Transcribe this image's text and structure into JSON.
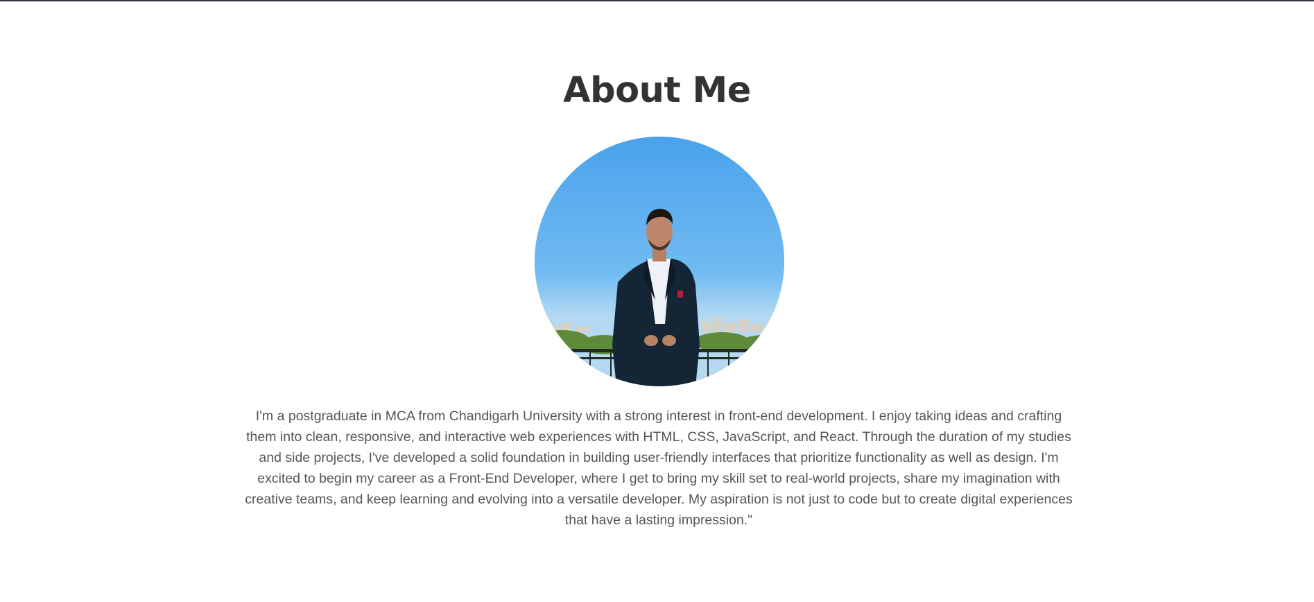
{
  "about": {
    "title": "About Me",
    "photo_alt": "Profile photo",
    "description": "I'm a postgraduate in MCA from Chandigarh University with a strong interest in front-end development. I enjoy taking ideas and crafting them into clean, responsive, and interactive web experiences with HTML, CSS, JavaScript, and React. Through the duration of my studies and side projects, I've developed a solid foundation in building user-friendly interfaces that prioritize functionality as well as design. I'm excited to begin my career as a Front-End Developer, where I get to bring my skill set to real-world projects, share my imagination with creative teams, and keep learning and evolving into a versatile developer. My aspiration is not just to code but to create digital experiences that have a lasting impression.\""
  },
  "colors": {
    "title": "#333333",
    "body_text": "#555555",
    "top_rule": "#2b3440",
    "background": "#ffffff"
  }
}
